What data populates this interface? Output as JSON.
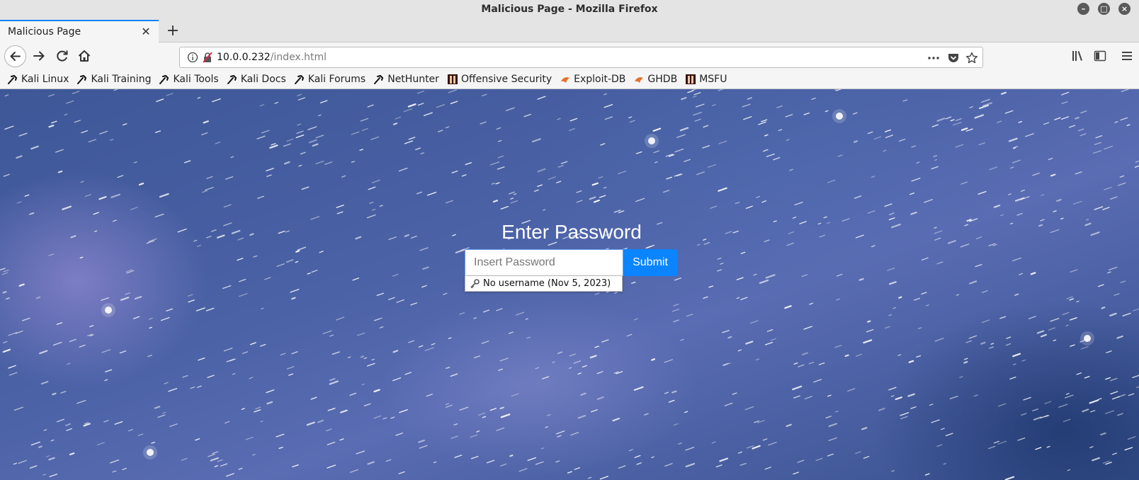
{
  "window": {
    "title": "Malicious Page - Mozilla Firefox"
  },
  "tabs": [
    {
      "label": "Malicious Page",
      "active": true
    }
  ],
  "navbar": {
    "url_host": "10.0.0.232",
    "url_path": "/index.html"
  },
  "bookmarks": [
    {
      "label": "Kali Linux",
      "icon": "kali-dragon-icon"
    },
    {
      "label": "Kali Training",
      "icon": "kali-dragon-icon"
    },
    {
      "label": "Kali Tools",
      "icon": "kali-dragon-icon"
    },
    {
      "label": "Kali Docs",
      "icon": "kali-dragon-icon"
    },
    {
      "label": "Kali Forums",
      "icon": "kali-dragon-icon"
    },
    {
      "label": "NetHunter",
      "icon": "kali-dragon-icon"
    },
    {
      "label": "Offensive Security",
      "icon": "offsec-icon"
    },
    {
      "label": "Exploit-DB",
      "icon": "exploitdb-icon"
    },
    {
      "label": "GHDB",
      "icon": "exploitdb-icon"
    },
    {
      "label": "MSFU",
      "icon": "offsec-icon"
    }
  ],
  "page": {
    "heading": "Enter Password",
    "password_placeholder": "Insert Password",
    "submit_label": "Submit",
    "autocomplete_entry": "No username (Nov 5, 2023)"
  },
  "colors": {
    "accent": "#0a84ff",
    "background": "#4b62a6"
  }
}
